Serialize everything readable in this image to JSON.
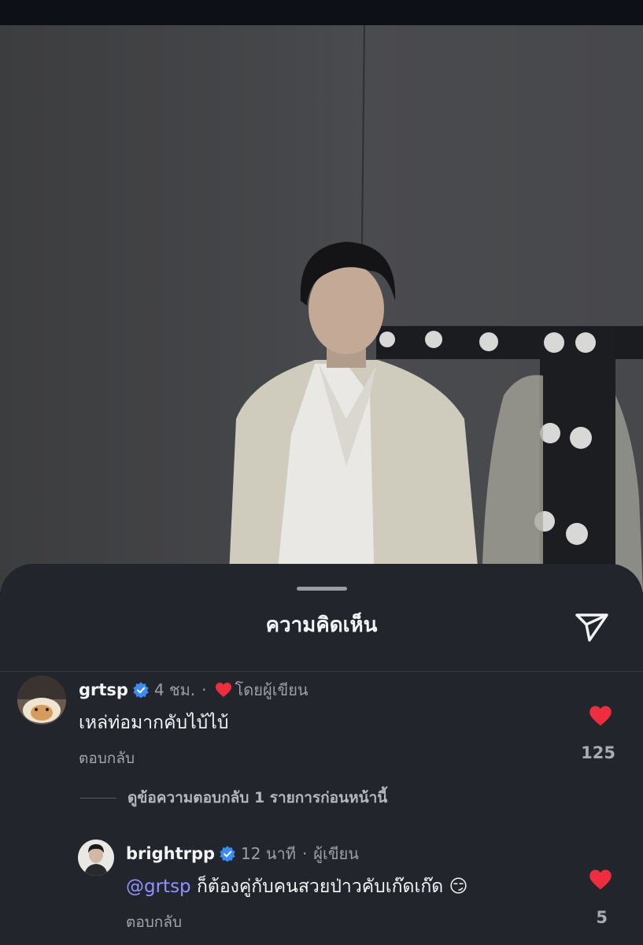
{
  "sheet": {
    "title": "ความคิดเห็น"
  },
  "comments": [
    {
      "username": "grtsp",
      "time": "4 ชม.",
      "separator": "·",
      "badge": "โดยผู้เขียน",
      "text": "เหล่ท่อมากคับไบ้ไบ้",
      "reply_label": "ตอบกลับ",
      "likes": "125"
    }
  ],
  "view_replies": "ดูข้อความตอบกลับ 1 รายการก่อนหน้านี้",
  "reply": {
    "username": "brightrpp",
    "time": "12 นาที",
    "separator": "·",
    "badge": "ผู้เขียน",
    "mention": "@grtsp",
    "text": " ก็ต้องคู่กับคนสวยป่าวคับเก๊ดเก๊ด",
    "emoji": "😏",
    "reply_label": "ตอบกลับ",
    "likes": "5"
  },
  "colors": {
    "accent_heart": "#ee2d3f",
    "verified": "#3a8cf0",
    "mention": "#8f93ff",
    "sheet_bg": "#23252d"
  },
  "icons": {
    "share": "send-icon",
    "verified": "verified-badge-icon",
    "like": "heart-icon"
  }
}
